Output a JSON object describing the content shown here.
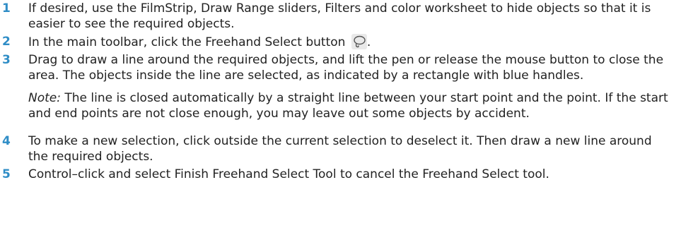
{
  "steps": [
    {
      "number": "1",
      "text": "If desired, use the FilmStrip, Draw Range sliders, Filters and color worksheet to hide objects so that it is easier to see the required objects."
    },
    {
      "number": "2",
      "text_before": "In the main toolbar, click the Freehand Select button ",
      "icon": "freehand-select-lasso-icon",
      "text_after": "."
    },
    {
      "number": "3",
      "text": "Drag to draw a line around the required objects, and lift the pen or release the mouse button to close the area. The objects inside the line are selected, as indicated by a rectangle with blue handles.",
      "note_label": "Note:",
      "note_text": " The line is closed automatically by a straight line between your start point and the point. If the start and end points are not close enough, you may leave out some objects by accident."
    },
    {
      "number": "4",
      "text": "To make a new selection, click outside the current selection to deselect it. Then draw a new line around the required objects."
    },
    {
      "number": "5",
      "text": "Control–click and select Finish Freehand Select Tool to cancel the Freehand Select tool."
    }
  ],
  "colors": {
    "step_number": "#2f8dc6",
    "text": "#222222",
    "icon_background": "#e9e9e9"
  }
}
